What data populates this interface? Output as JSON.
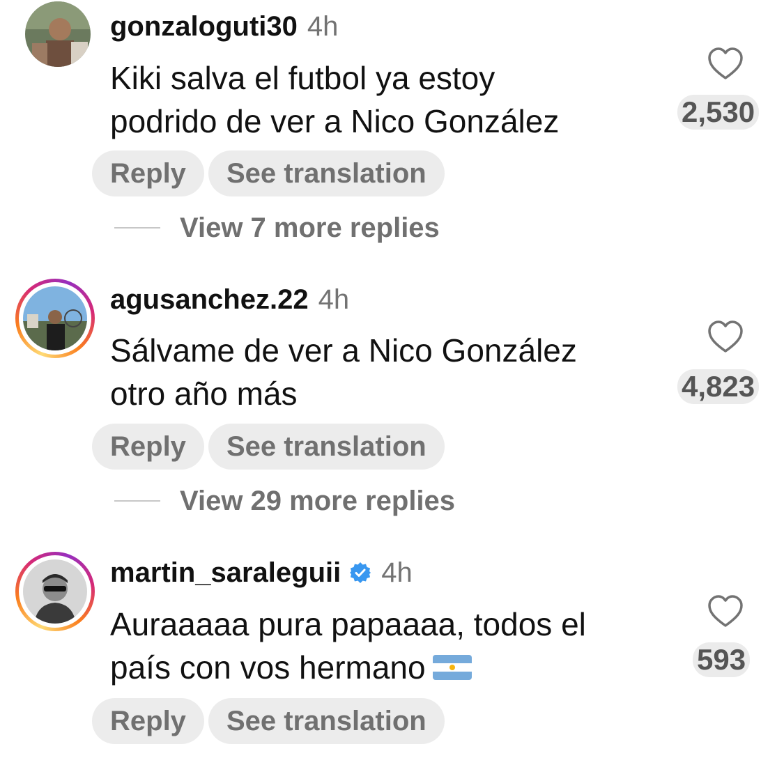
{
  "comments": [
    {
      "username": "gonzaloguti30",
      "time": "4h",
      "verified": false,
      "story_ring": false,
      "text_lines": [
        "Kiki salva el futbol ya estoy",
        "podrido de ver a Nico González"
      ],
      "likes": "2,530",
      "reply_label": "Reply",
      "translate_label": "See translation",
      "view_replies": "View 7 more replies"
    },
    {
      "username": "agusanchez.22",
      "time": "4h",
      "verified": false,
      "story_ring": true,
      "text_lines": [
        "Sálvame de ver a Nico González",
        "otro año más"
      ],
      "likes": "4,823",
      "reply_label": "Reply",
      "translate_label": "See translation",
      "view_replies": "View 29 more replies"
    },
    {
      "username": "martin_saraleguii",
      "time": "4h",
      "verified": true,
      "story_ring": true,
      "text_lines": [
        "Auraaaaa pura papaaaa, todos el",
        "país con vos hermano"
      ],
      "flag_emoji": "argentina-flag",
      "likes": "593",
      "reply_label": "Reply",
      "translate_label": "See translation"
    }
  ],
  "colors": {
    "username": "#111111",
    "secondary": "#737373",
    "pill_bg": "#ececec",
    "verified": "#3897f0"
  }
}
